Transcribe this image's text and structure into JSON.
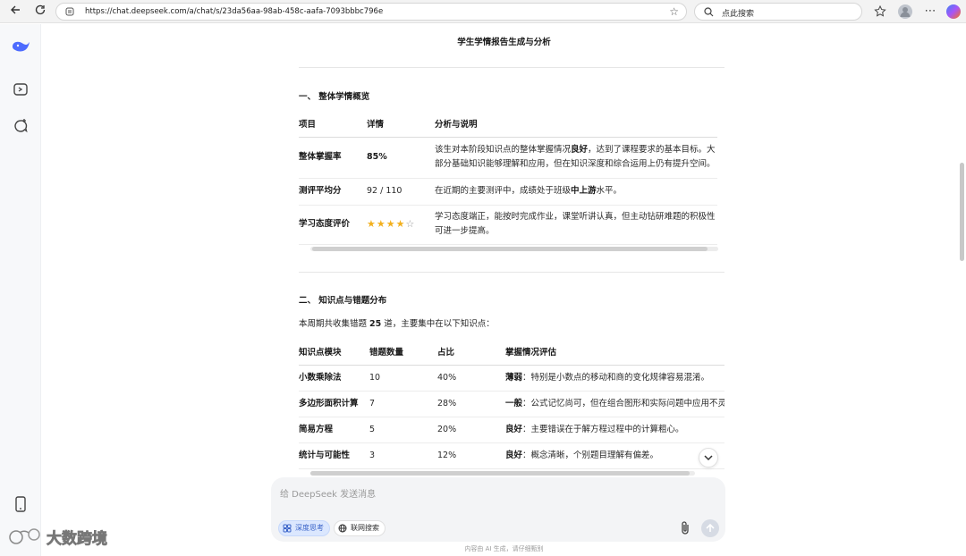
{
  "browser": {
    "url": "https://chat.deepseek.com/a/chat/s/23da56aa-98ab-458c-aafa-7093bbbc796e",
    "search_placeholder": "点此搜索"
  },
  "doc": {
    "title": "学生学情报告生成与分析",
    "section1": {
      "heading": "一、 整体学情概览",
      "headers": [
        "项目",
        "详情",
        "分析与说明"
      ],
      "rows": [
        {
          "item": "整体掌握率",
          "detail": "85%",
          "analysis_pre": "该生对本阶段知识点的整体掌握情况",
          "analysis_hl": "良好",
          "analysis_post": "，达到了课程要求的基本目标。大部分基础知识能够理解和应用，但在知识深度和综合运用上仍有提升空间。"
        },
        {
          "item": "测评平均分",
          "detail": "92 / 110",
          "analysis_pre": "在近期的主要测评中，成绩处于班级",
          "analysis_hl": "中上游",
          "analysis_post": "水平。"
        },
        {
          "item": "学习态度评价",
          "detail_stars_filled": "★★★★",
          "detail_stars_empty": "☆",
          "rating": 4,
          "rating_max": 5,
          "analysis_pre": "学习态度端正，能按时完成作业，课堂听讲认真，但主动钻研难题的积极性可进一步提高。",
          "analysis_hl": "",
          "analysis_post": ""
        }
      ]
    },
    "section2": {
      "heading": "二、 知识点与错题分布",
      "intro_pre": "本周期共收集错题 ",
      "intro_count": "25",
      "intro_post": " 道，主要集中在以下知识点：",
      "headers": [
        "知识点模块",
        "错题数量",
        "占比",
        "掌握情况评估"
      ],
      "rows": [
        {
          "module": "小数乘除法",
          "count": "10",
          "ratio": "40%",
          "level": "薄弱",
          "note": "：特别是小数点的移动和商的变化规律容易混淆。"
        },
        {
          "module": "多边形面积计算",
          "count": "7",
          "ratio": "28%",
          "level": "一般",
          "note": "：公式记忆尚可，但在组合图形和实际问题中应用不灵"
        },
        {
          "module": "简易方程",
          "count": "5",
          "ratio": "20%",
          "level": "良好",
          "note": "：主要错误在于解方程过程中的计算粗心。"
        },
        {
          "module": "统计与可能性",
          "count": "3",
          "ratio": "12%",
          "level": "良好",
          "note": "：概念清晰，个别题目理解有偏差。"
        }
      ]
    }
  },
  "composer": {
    "placeholder": "给 DeepSeek 发送消息",
    "deep_think_label": "深度思考",
    "web_search_label": "联网搜索"
  },
  "footer_note": "内容由 AI 生成，请仔细甄别",
  "watermark": "大数跨境",
  "colors": {
    "accent": "#4d6bfe",
    "star": "#f2b01e",
    "chip_bg": "#dbe7fe"
  }
}
